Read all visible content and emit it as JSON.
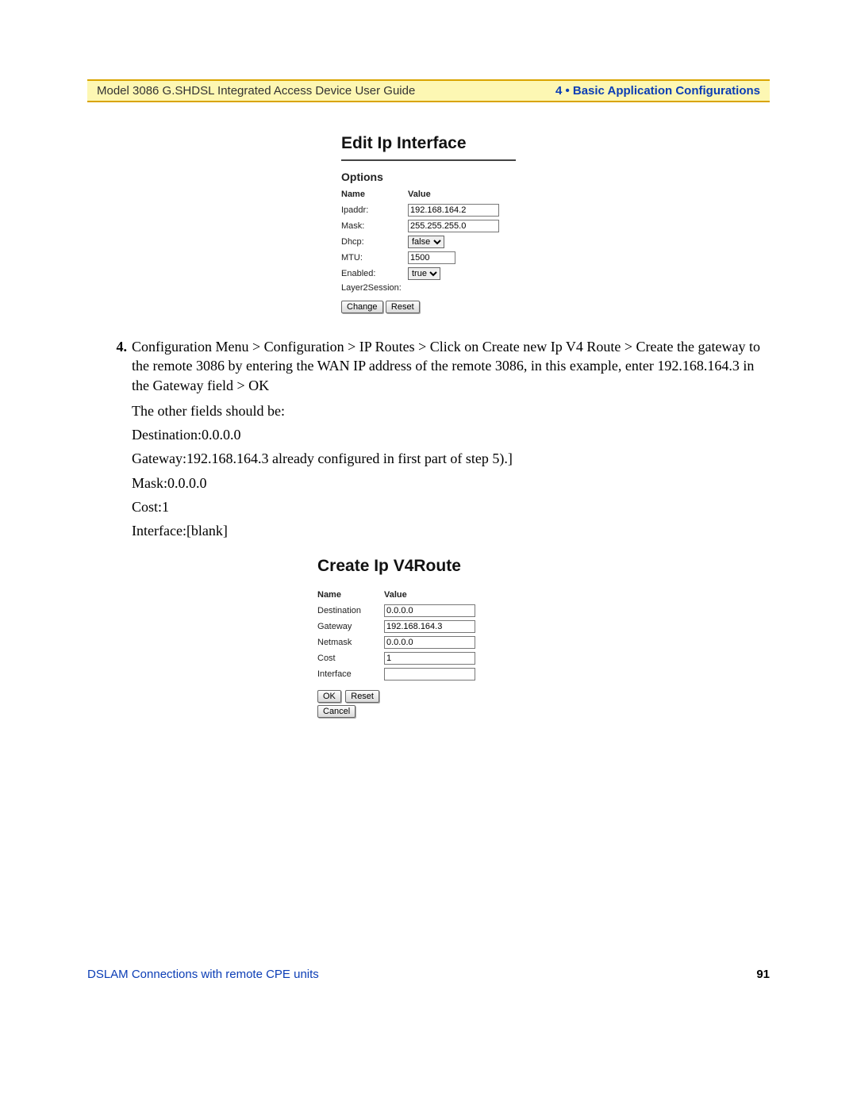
{
  "header": {
    "left": "Model 3086 G.SHDSL Integrated Access Device User Guide",
    "right": "4 • Basic Application Configurations"
  },
  "edit_ip": {
    "title": "Edit Ip Interface",
    "subtitle": "Options",
    "th_name": "Name",
    "th_value": "Value",
    "rows": {
      "ipaddr_label": "Ipaddr:",
      "ipaddr_value": "192.168.164.2",
      "mask_label": "Mask:",
      "mask_value": "255.255.255.0",
      "dhcp_label": "Dhcp:",
      "dhcp_value": "false",
      "mtu_label": "MTU:",
      "mtu_value": "1500",
      "enabled_label": "Enabled:",
      "enabled_value": "true",
      "l2_label": "Layer2Session:"
    },
    "btn_change": "Change",
    "btn_reset": "Reset"
  },
  "step4": {
    "num": "4.",
    "text": "Configuration Menu > Configuration > IP Routes > Click on Create new Ip V4 Route > Create the gateway to the remote 3086 by entering the WAN IP address of the remote 3086, in this example, enter 192.168.164.3 in the Gateway field > OK",
    "p1": "The other fields should be:",
    "p2": "Destination:0.0.0.0",
    "p3": "Gateway:192.168.164.3  already configured in first part of step 5).]",
    "p4": "Mask:0.0.0.0",
    "p5": "Cost:1",
    "p6": "Interface:[blank]"
  },
  "create_route": {
    "title": "Create Ip V4Route",
    "th_name": "Name",
    "th_value": "Value",
    "rows": {
      "dest_label": "Destination",
      "dest_value": "0.0.0.0",
      "gw_label": "Gateway",
      "gw_value": "192.168.164.3",
      "nm_label": "Netmask",
      "nm_value": "0.0.0.0",
      "cost_label": "Cost",
      "cost_value": "1",
      "if_label": "Interface",
      "if_value": ""
    },
    "btn_ok": "OK",
    "btn_reset": "Reset",
    "btn_cancel": "Cancel"
  },
  "footer": {
    "left": "DSLAM Connections with remote CPE units",
    "right": "91"
  }
}
